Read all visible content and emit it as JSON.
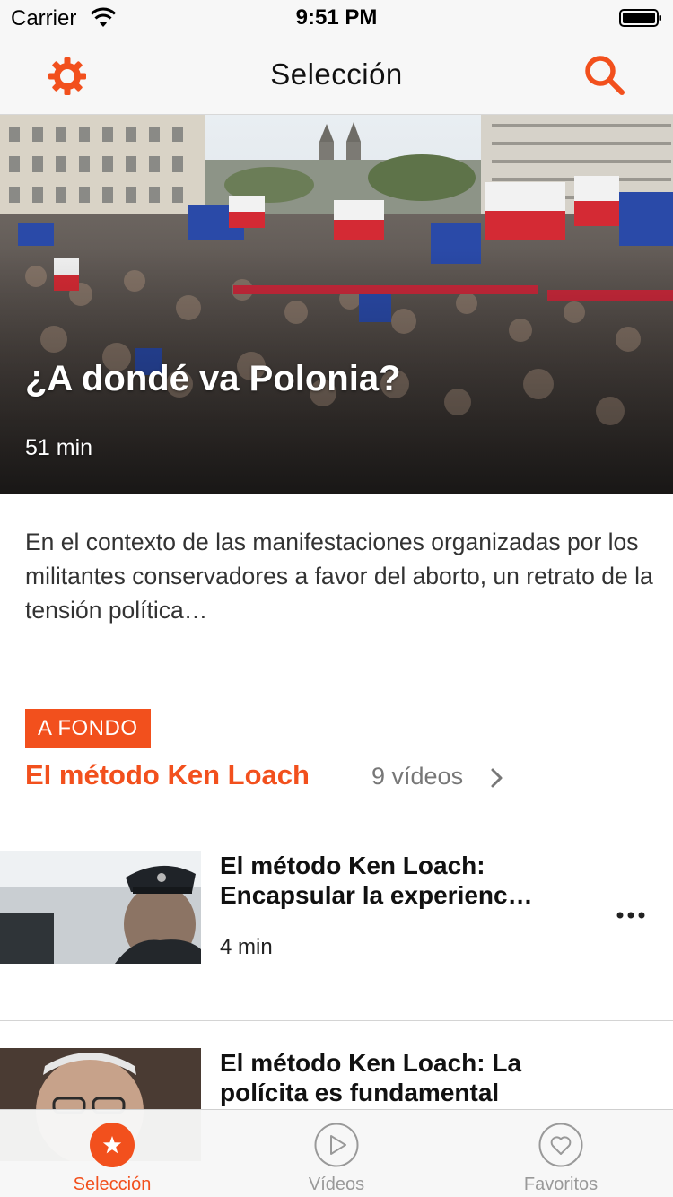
{
  "status_bar": {
    "carrier": "Carrier",
    "time": "9:51 PM"
  },
  "nav": {
    "title": "Selección",
    "left_icon": "gear-icon",
    "right_icon": "search-icon"
  },
  "hero": {
    "title": "¿A dondé va Polonia?",
    "duration": "51 min"
  },
  "description": "En el contexto de las manifestaciones organizadas por los militantes conservadores a favor del aborto, un retrato de la tensión política…",
  "section": {
    "tag": "A FONDO",
    "title": "El método Ken Loach",
    "count": "9 vídeos"
  },
  "list": [
    {
      "title": "El método Ken Loach: Encapsular la experienc…",
      "duration": "4 min"
    },
    {
      "title": "El método Ken Loach: La polícita es fundamental"
    }
  ],
  "tabs": [
    {
      "label": "Selección",
      "icon": "star-icon",
      "active": true
    },
    {
      "label": "Vídeos",
      "icon": "play-icon",
      "active": false
    },
    {
      "label": "Favoritos",
      "icon": "heart-icon",
      "active": false
    }
  ],
  "colors": {
    "accent": "#f2501d",
    "bar_bg": "#f7f7f7",
    "text": "#111111",
    "muted": "#777777"
  }
}
